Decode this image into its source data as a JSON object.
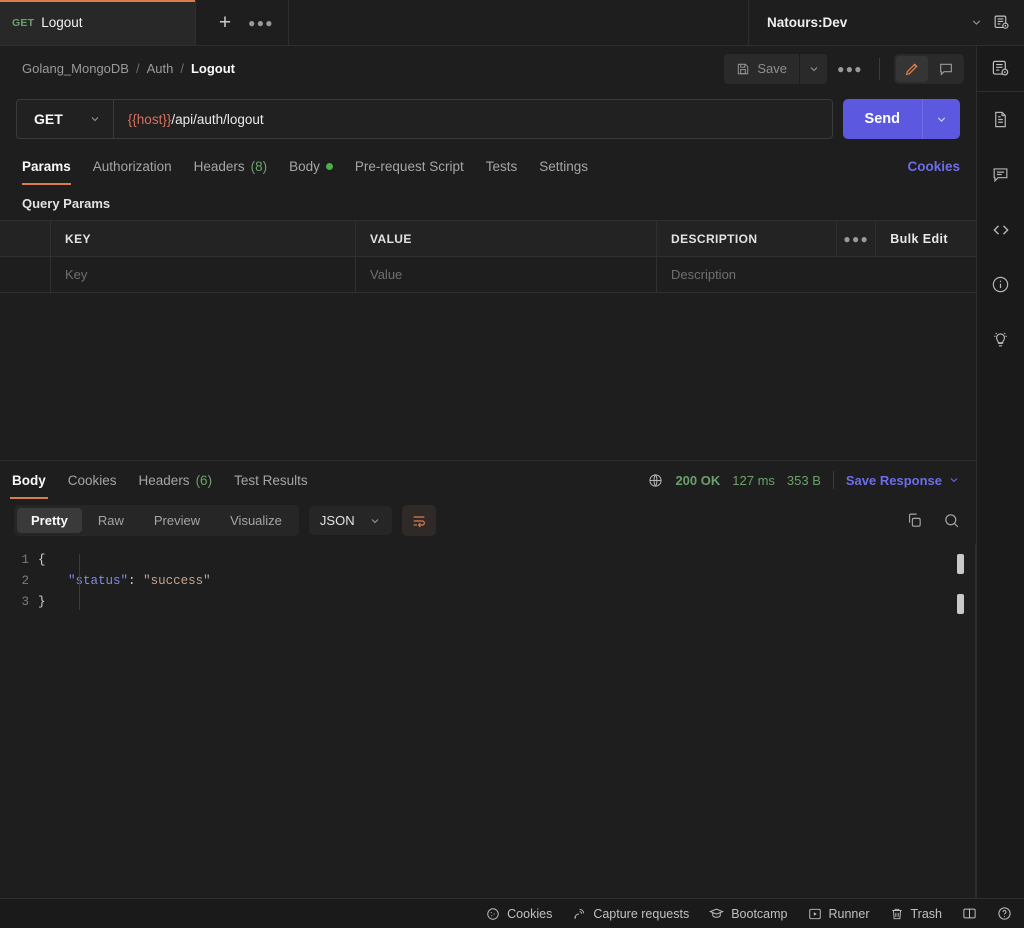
{
  "tab": {
    "method": "GET",
    "name": "Logout",
    "new_tab_icon": "plus-icon",
    "more_icon": "ellipsis-icon"
  },
  "environment": {
    "name": "Natours:Dev",
    "chevron_icon": "chevron-down-icon",
    "quicklook_icon": "environment-quick-look-icon"
  },
  "breadcrumb": {
    "collection": "Golang_MongoDB",
    "folder": "Auth",
    "request": "Logout",
    "separator": "/"
  },
  "request_actions": {
    "save_label": "Save",
    "save_icon": "floppy-disk-icon",
    "save_caret_icon": "chevron-down-icon",
    "more_icon": "ellipsis-icon",
    "edit_icon": "pencil-icon",
    "comment_icon": "comment-icon"
  },
  "url": {
    "method": "GET",
    "method_caret_icon": "chevron-down-icon",
    "variable": "{{host}}",
    "path": "/api/auth/logout",
    "send_label": "Send",
    "send_caret_icon": "chevron-down-icon",
    "accent": "#5c59e0"
  },
  "request_tabs": {
    "items": [
      {
        "label": "Params",
        "count": "",
        "dot": false
      },
      {
        "label": "Authorization",
        "count": "",
        "dot": false
      },
      {
        "label": "Headers",
        "count": "(8)",
        "dot": false
      },
      {
        "label": "Body",
        "count": "",
        "dot": true
      },
      {
        "label": "Pre-request Script",
        "count": "",
        "dot": false
      },
      {
        "label": "Tests",
        "count": "",
        "dot": false
      },
      {
        "label": "Settings",
        "count": "",
        "dot": false
      }
    ],
    "active": "Params",
    "cookies_link": "Cookies"
  },
  "params": {
    "section_title": "Query Params",
    "columns": [
      "KEY",
      "VALUE",
      "DESCRIPTION"
    ],
    "rows": [
      {
        "key": "Key",
        "value": "Value",
        "description": "Description"
      }
    ],
    "more_icon": "ellipsis-icon",
    "bulk_edit_label": "Bulk Edit"
  },
  "response": {
    "tabs": [
      {
        "label": "Body",
        "count": ""
      },
      {
        "label": "Cookies",
        "count": ""
      },
      {
        "label": "Headers",
        "count": "(6)"
      },
      {
        "label": "Test Results",
        "count": ""
      }
    ],
    "active": "Body",
    "network_icon": "globe-icon",
    "status": "200 OK",
    "time": "127 ms",
    "size": "353 B",
    "save_response_label": "Save Response",
    "save_response_caret_icon": "chevron-down-icon",
    "views": [
      "Pretty",
      "Raw",
      "Preview",
      "Visualize"
    ],
    "active_view": "Pretty",
    "language": "JSON",
    "language_caret_icon": "chevron-down-icon",
    "wrap_icon": "word-wrap-icon",
    "copy_icon": "copy-icon",
    "search_icon": "search-icon",
    "status_color": "#6ba06b",
    "link_color": "#6d6ced",
    "code_lines": [
      {
        "no": "1",
        "open_brace": "{"
      },
      {
        "no": "2",
        "key": "\"status\"",
        "colon": ":",
        "value": "\"success\""
      },
      {
        "no": "3",
        "close_brace": "}"
      }
    ]
  },
  "right_rail": {
    "items": [
      {
        "icon": "environment-quick-look-icon"
      },
      {
        "icon": "documentation-icon"
      },
      {
        "icon": "comment-icon"
      },
      {
        "icon": "code-snippet-icon"
      },
      {
        "icon": "info-icon"
      },
      {
        "icon": "lightbulb-icon"
      }
    ]
  },
  "status_bar": {
    "items": [
      {
        "label": "Cookies",
        "icon": "cookie-icon"
      },
      {
        "label": "Capture requests",
        "icon": "satellite-icon"
      },
      {
        "label": "Bootcamp",
        "icon": "graduation-cap-icon"
      },
      {
        "label": "Runner",
        "icon": "runner-icon"
      },
      {
        "label": "Trash",
        "icon": "trash-icon"
      }
    ],
    "layout_icon": "two-pane-layout-icon",
    "help_icon": "help-circle-icon"
  }
}
